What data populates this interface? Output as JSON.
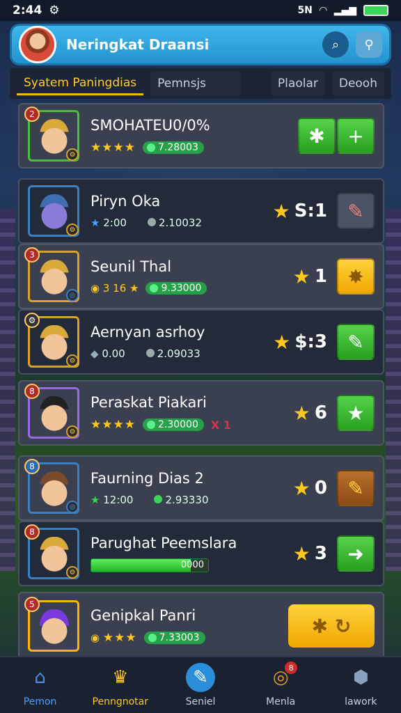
{
  "status": {
    "time": "2:44",
    "network": "5N"
  },
  "header": {
    "title": "Neringkat Draansi"
  },
  "tabs": [
    {
      "label": "Syatem Paningdias"
    },
    {
      "label": "Pemnsjs"
    },
    {
      "label": "Plaolar"
    },
    {
      "label": "Deooh"
    }
  ],
  "rows": [
    {
      "rank": "2",
      "name": "SMOHATEU0/0%",
      "stars": "★★★★",
      "value": "7.28003"
    },
    {
      "name": "Piryn Oka",
      "stat1": "2:00",
      "stat2": "2.10032",
      "score": "S:1"
    },
    {
      "rank": "3",
      "name": "Seunil Thal",
      "stat1": "3 16",
      "value": "9.33000",
      "score": "1"
    },
    {
      "name": "Aernyan asrhoy",
      "stat1": "0.00",
      "stat2": "2.09033",
      "score": "$:3"
    },
    {
      "rank": "8",
      "name": "Peraskat Piakari",
      "stars": "★★★★",
      "value": "2.30000",
      "extra": "X 1",
      "score": "6"
    },
    {
      "rank": "8",
      "name": "Faurning Dias 2",
      "stat1": "12:00",
      "stat2": "2.93330",
      "score": "0"
    },
    {
      "rank": "8",
      "name": "Parughat Peemslara",
      "bar_label": "0000",
      "bar_fill": 0.85,
      "score": "3"
    },
    {
      "rank": "5",
      "name": "Genipkal Panri",
      "stars": "★★★",
      "value": "7.33003"
    }
  ],
  "nav": [
    {
      "label": "Pemon"
    },
    {
      "label": "Penngnotar"
    },
    {
      "label": "Seniel"
    },
    {
      "label": "Menla",
      "badge": "8"
    },
    {
      "label": "lawork"
    }
  ]
}
